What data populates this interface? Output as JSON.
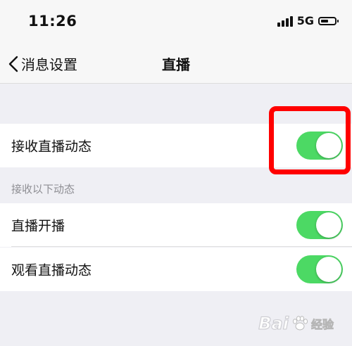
{
  "status_bar": {
    "time": "11:26",
    "network": "5G",
    "signal_bars": 4
  },
  "nav": {
    "back_label": "消息设置",
    "title": "直播"
  },
  "settings": {
    "main_toggle": {
      "label": "接收直播动态",
      "enabled": true
    },
    "section_header": "接收以下动态",
    "items": [
      {
        "label": "直播开播",
        "enabled": true
      },
      {
        "label": "观看直播动态",
        "enabled": true
      }
    ]
  },
  "colors": {
    "toggle_on": "#4cd964",
    "highlight": "#ff0000",
    "background": "#efeff4"
  },
  "watermark": {
    "brand": "Bai",
    "sub": "经验"
  }
}
